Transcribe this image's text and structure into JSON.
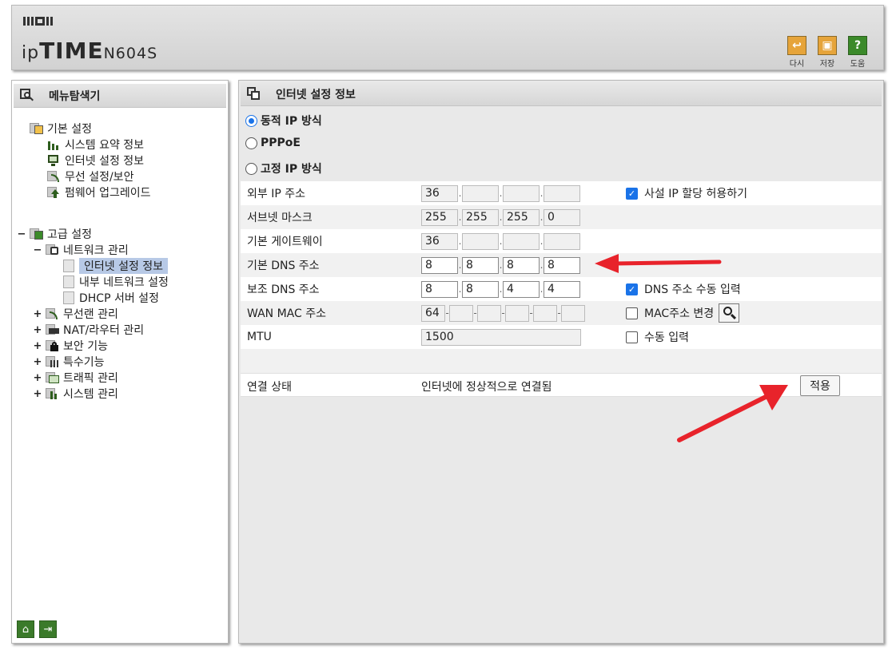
{
  "header": {
    "logo_ip": "ip",
    "logo_time": "TIME",
    "model": "N604S",
    "buttons": [
      {
        "label": "다시",
        "icon": "undo-icon",
        "color": "#e6a43a"
      },
      {
        "label": "저장",
        "icon": "save-icon",
        "color": "#e6a43a"
      },
      {
        "label": "도움",
        "icon": "help-icon",
        "color": "#3b8a2a"
      }
    ]
  },
  "sidebar": {
    "title": "메뉴탐색기",
    "basic": {
      "label": "기본 설정",
      "items": [
        "시스템 요약 정보",
        "인터넷 설정 정보",
        "무선 설정/보안",
        "펌웨어 업그레이드"
      ]
    },
    "advanced": {
      "label": "고급 설정",
      "network": {
        "label": "네트워크 관리",
        "items": [
          "인터넷 설정 정보",
          "내부 네트워크 설정",
          "DHCP 서버 설정"
        ]
      },
      "groups": [
        "무선랜 관리",
        "NAT/라우터 관리",
        "보안 기능",
        "특수기능",
        "트래픽 관리",
        "시스템 관리"
      ]
    },
    "selected": "인터넷 설정 정보"
  },
  "main": {
    "title": "인터넷 설정 정보",
    "modes": [
      {
        "label": "동적 IP 방식",
        "selected": true
      },
      {
        "label": "PPPoE",
        "selected": false
      },
      {
        "label": "고정 IP 방식",
        "selected": false
      }
    ],
    "rows": {
      "ext_ip": {
        "label": "외부 IP 주소",
        "octets": [
          "36",
          "",
          "",
          ""
        ]
      },
      "subnet": {
        "label": "서브넷 마스크",
        "octets": [
          "255",
          "255",
          "255",
          "0"
        ]
      },
      "gateway": {
        "label": "기본 게이트웨이",
        "octets": [
          "36",
          "",
          "",
          ""
        ]
      },
      "dns1": {
        "label": "기본 DNS 주소",
        "octets": [
          "8",
          "8",
          "8",
          "8"
        ]
      },
      "dns2": {
        "label": "보조 DNS 주소",
        "octets": [
          "8",
          "8",
          "4",
          "4"
        ]
      },
      "mac": {
        "label": "WAN MAC 주소",
        "parts": [
          "64",
          "",
          "",
          "",
          "",
          ""
        ]
      },
      "mtu": {
        "label": "MTU",
        "value": "1500"
      }
    },
    "options": {
      "private_ip": {
        "label": "사설 IP 할당 허용하기",
        "checked": true
      },
      "dns_manual": {
        "label": "DNS 주소 수동 입력",
        "checked": true
      },
      "mac_change": {
        "label": "MAC주소 변경",
        "checked": false
      },
      "mtu_manual": {
        "label": "수동 입력",
        "checked": false
      }
    },
    "status": {
      "label": "연결 상태",
      "value": "인터넷에 정상적으로 연결됨"
    },
    "apply_label": "적용"
  },
  "colors": {
    "accent": "#1a73e8",
    "annotation": "#e8232b",
    "selection": "#b7c9e6"
  }
}
